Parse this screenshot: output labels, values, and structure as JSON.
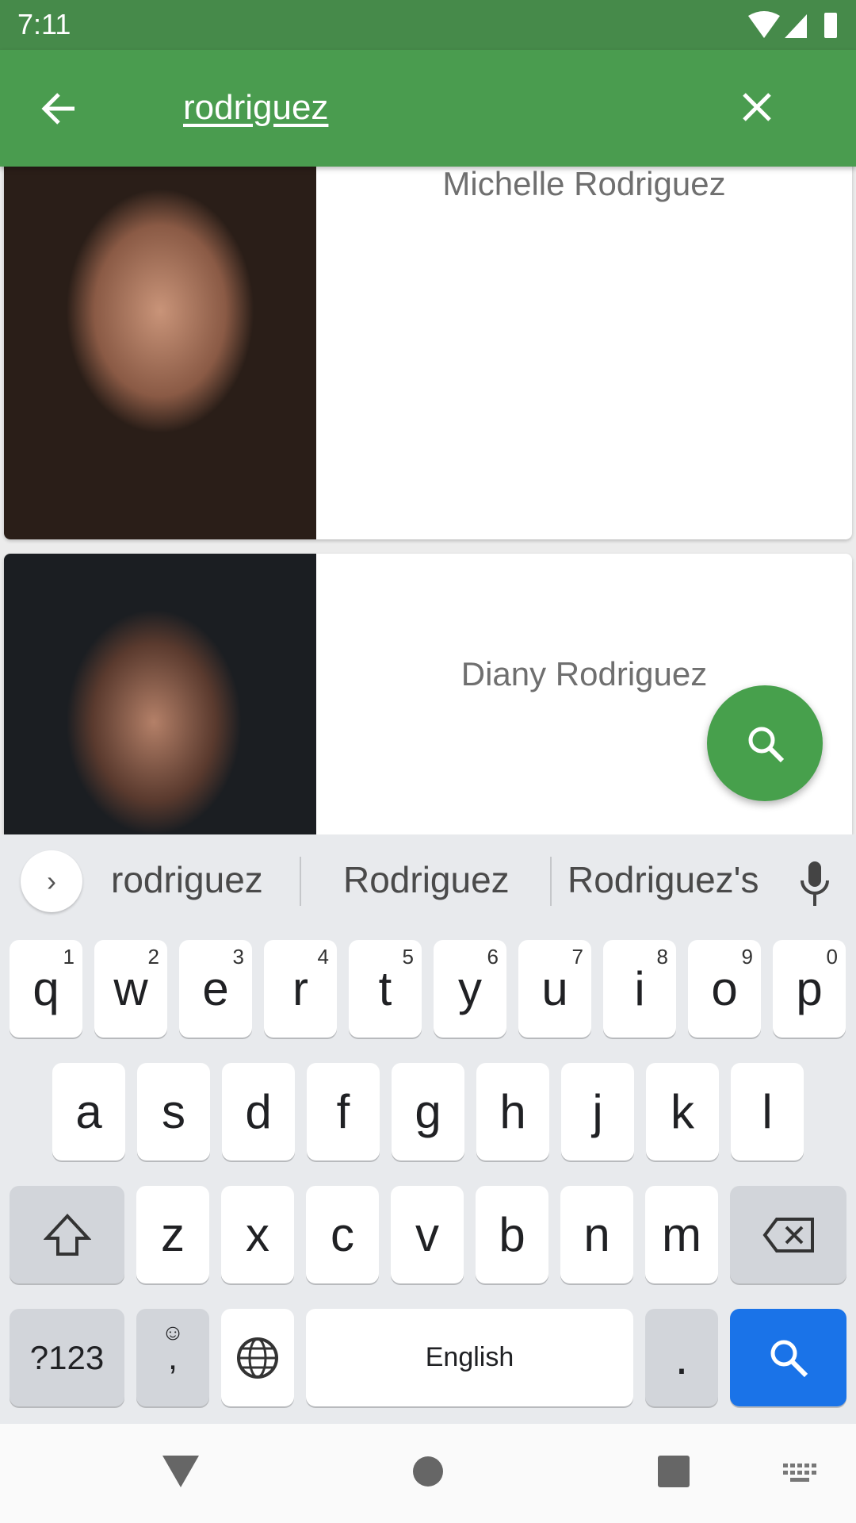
{
  "status_bar": {
    "time": "7:11",
    "icons": [
      "wifi-icon",
      "signal-icon",
      "battery-icon"
    ]
  },
  "app_bar": {
    "back_icon": "arrow-left-icon",
    "query": "rodriguez",
    "clear_icon": "close-icon"
  },
  "results": [
    {
      "name": "Michelle Rodriguez"
    },
    {
      "name": "Diany Rodriguez"
    }
  ],
  "fab": {
    "icon": "search-refresh-icon"
  },
  "keyboard": {
    "suggestions": [
      "rodriguez",
      "Rodriguez",
      "Rodriguez's"
    ],
    "row1": [
      {
        "k": "q",
        "n": "1"
      },
      {
        "k": "w",
        "n": "2"
      },
      {
        "k": "e",
        "n": "3"
      },
      {
        "k": "r",
        "n": "4"
      },
      {
        "k": "t",
        "n": "5"
      },
      {
        "k": "y",
        "n": "6"
      },
      {
        "k": "u",
        "n": "7"
      },
      {
        "k": "i",
        "n": "8"
      },
      {
        "k": "o",
        "n": "9"
      },
      {
        "k": "p",
        "n": "0"
      }
    ],
    "row2": [
      "a",
      "s",
      "d",
      "f",
      "g",
      "h",
      "j",
      "k",
      "l"
    ],
    "row3": [
      "z",
      "x",
      "c",
      "v",
      "b",
      "n",
      "m"
    ],
    "symbols_label": "?123",
    "comma_label": ",",
    "space_label": "English",
    "period_label": ".",
    "action_color": "#1a73e8"
  },
  "colors": {
    "status": "#468a4a",
    "appbar": "#4a9c4f",
    "fab": "#47a04c"
  }
}
